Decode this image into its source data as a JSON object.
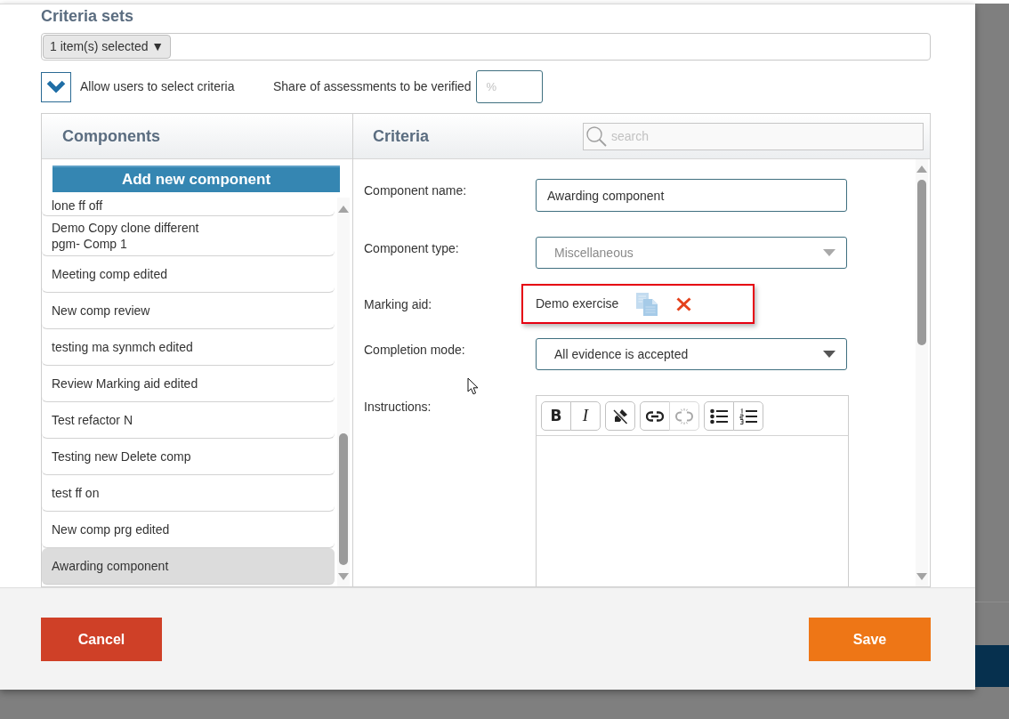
{
  "criteria_sets": {
    "title": "Criteria sets",
    "selector": {
      "label": "1 item(s) selected",
      "caret": "▼"
    }
  },
  "options": {
    "allow_select": {
      "label": "Allow users to select criteria",
      "checked": true
    },
    "verification_share": {
      "label": "Share of assessments to be verified",
      "placeholder": "%"
    }
  },
  "components_panel": {
    "title": "Components",
    "add_button": "Add new component",
    "items": [
      {
        "label": "lone ff off",
        "selected": false
      },
      {
        "label": "Demo Copy clone different pgm- Comp 1",
        "selected": false
      },
      {
        "label": "Meeting comp edited",
        "selected": false
      },
      {
        "label": "New comp review",
        "selected": false
      },
      {
        "label": "testing ma synmch edited",
        "selected": false
      },
      {
        "label": "Review Marking aid edited",
        "selected": false
      },
      {
        "label": "Test refactor N",
        "selected": false
      },
      {
        "label": "Testing new Delete comp",
        "selected": false
      },
      {
        "label": "test ff on",
        "selected": false
      },
      {
        "label": "New comp prg edited",
        "selected": false
      },
      {
        "label": "Awarding component",
        "selected": true
      }
    ]
  },
  "criteria_panel": {
    "title": "Criteria",
    "search": {
      "placeholder": "search"
    },
    "fields": [
      {
        "kind": "text",
        "label": "Component name:",
        "value": "Awarding component",
        "disabled": false
      },
      {
        "kind": "select",
        "label": "Component type:",
        "value": "Miscellaneous",
        "disabled": true
      },
      {
        "kind": "attachment",
        "label": "Marking aid:",
        "value": "Demo exercise",
        "highlighted": true
      },
      {
        "kind": "select",
        "label": "Completion mode:",
        "value": "All evidence is accepted",
        "disabled": false
      },
      {
        "kind": "editor",
        "label": "Instructions:",
        "toolbar_groups": [
          {
            "buttons": [
              {
                "kind": "bold",
                "label": "B",
                "disabled": false
              },
              {
                "kind": "italic",
                "label": "I",
                "disabled": false
              }
            ]
          },
          {
            "buttons": [
              {
                "kind": "clear_format",
                "disabled": false
              }
            ]
          },
          {
            "buttons": [
              {
                "kind": "link",
                "disabled": false
              },
              {
                "kind": "unlink",
                "disabled": true
              }
            ]
          },
          {
            "buttons": [
              {
                "kind": "bullet_list",
                "disabled": false
              },
              {
                "kind": "numbered_list",
                "disabled": false
              }
            ]
          }
        ]
      }
    ]
  },
  "footer": {
    "buttons": [
      {
        "label": "Cancel",
        "kind": "cancel"
      },
      {
        "label": "Save",
        "kind": "confirm"
      }
    ]
  }
}
